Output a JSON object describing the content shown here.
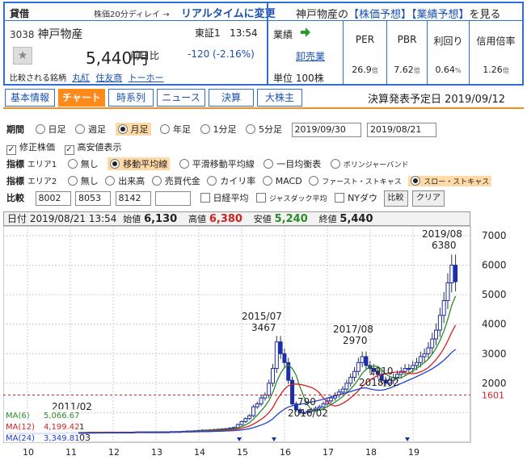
{
  "header": {
    "loan_label": "貸借",
    "delay_note": "株価20分ディレイ →",
    "realtime_link": "リアルタイムに変更",
    "see_prefix": "神戸物産の",
    "stock_forecast_link": "【株価予想】",
    "earnings_forecast_link": "【業績予想】",
    "see_suffix": "を見る"
  },
  "stock": {
    "code": "3038",
    "name": "神戸物産",
    "market": "東証1",
    "time": "13:54",
    "price": "5,440円",
    "diff_label": "前日比",
    "diff_value": "-120 (-2.16%)",
    "compare_label": "比較される銘柄",
    "compare_links": [
      "丸紅",
      "住友商",
      "トーホー"
    ]
  },
  "performance": {
    "label": "業績",
    "link": "卸売業",
    "unit": "単位 100株"
  },
  "stats": [
    {
      "header": "PER",
      "value": "26.9",
      "unit": "倍"
    },
    {
      "header": "PBR",
      "value": "7.62",
      "unit": "倍"
    },
    {
      "header": "利回り",
      "value": "0.64",
      "unit": "%"
    },
    {
      "header": "信用倍率",
      "value": "1.26",
      "unit": "倍"
    }
  ],
  "tabs": [
    "基本情報",
    "チャート",
    "時系列",
    "ニュース",
    "決算",
    "大株主"
  ],
  "earnings_date": "決算発表予定日 2019/09/12",
  "period": {
    "label": "期間",
    "options": [
      "日足",
      "週足",
      "月足",
      "年足",
      "1分足",
      "5分足"
    ],
    "selected": "月足",
    "date_from": "2019/09/30",
    "date_to": "2019/08/21"
  },
  "checks": {
    "adjusted": "修正株価",
    "high_low": "高安値表示"
  },
  "indicator1": {
    "label": "指標",
    "area": "エリア1",
    "options": [
      "無し",
      "移動平均線",
      "平滑移動平均線",
      "一目均衡表",
      "ボリンジャーバンド"
    ],
    "selected": "移動平均線"
  },
  "indicator2": {
    "label": "指標",
    "area": "エリア2",
    "options": [
      "無し",
      "出来高",
      "売買代金",
      "カイリ率",
      "MACD",
      "ファースト・ストキャス",
      "スロー・ストキャス"
    ],
    "selected": "スロー・ストキャス"
  },
  "compare": {
    "label": "比較",
    "codes": [
      "8002",
      "8053",
      "8142",
      ""
    ],
    "checks": [
      "日経平均",
      "ジャスダック平均",
      "NYダウ"
    ],
    "compare_button": "比較",
    "clear_button": "クリア"
  },
  "chart_head": {
    "date_label": "日付",
    "date": "2019/08/21 13:54",
    "open_label": "始値",
    "open": "6,130",
    "high_label": "高値",
    "high": "6,380",
    "low_label": "安値",
    "low": "5,240",
    "close_label": "終値",
    "close": "5,440"
  },
  "chart_data": {
    "type": "candlestick",
    "ylim": [
      0,
      7000
    ],
    "yticks": [
      1000,
      2000,
      3000,
      4000,
      5000,
      6000,
      7000
    ],
    "ytick_labels": [
      "",
      "2000",
      "3000",
      "4000",
      "5000",
      "6000",
      "7000"
    ],
    "current_price_marker": "1601",
    "xticks": [
      "10",
      "11",
      "12",
      "13",
      "14",
      "15",
      "16",
      "17",
      "18",
      "19"
    ],
    "annotations": [
      {
        "label": "2019/08",
        "value": "6380"
      },
      {
        "label": "2015/07",
        "value": "3467"
      },
      {
        "label": "2017/08",
        "value": "2970"
      },
      {
        "label": "2018/02",
        "value": "1910"
      },
      {
        "label": "2016/02",
        "value": "790"
      },
      {
        "label": "2011/02",
        "value": ""
      }
    ],
    "ma": [
      {
        "name": "MA(6)",
        "value": "5,066.67",
        "color": "#2a8a2a"
      },
      {
        "name": "MA(12)",
        "value": "4,199.42",
        "color": "#d42020"
      },
      {
        "name": "MA(24)",
        "value": "3,349.81",
        "color": "#2040d0"
      }
    ],
    "bottom_note": "03",
    "bottom_left_value": "1",
    "close": [
      300,
      300,
      300,
      300,
      300,
      300,
      300,
      300,
      300,
      300,
      300,
      300,
      300,
      310,
      320,
      330,
      330,
      330,
      330,
      330,
      330,
      340,
      340,
      340,
      340,
      340,
      340,
      340,
      340,
      340,
      340,
      340,
      340,
      350,
      350,
      350,
      350,
      350,
      350,
      350,
      350,
      350,
      360,
      360,
      360,
      370,
      380,
      380,
      390,
      400,
      410,
      410,
      420,
      430,
      440,
      450,
      460,
      480,
      500,
      600,
      700,
      800,
      900,
      1200,
      1300,
      1500,
      1600,
      2000,
      2500,
      3400,
      3000,
      2700,
      2100,
      1300,
      1100,
      1000,
      1000,
      1050,
      1100,
      1150,
      1200,
      1300,
      1400,
      1500,
      1600,
      1700,
      1800,
      2000,
      2200,
      2400,
      2700,
      2900,
      2600,
      2500,
      2400,
      2300,
      2100,
      2000,
      2100,
      2200,
      2300,
      2400,
      2500,
      2500,
      2600,
      2700,
      2900,
      3000,
      3200,
      3500,
      3800,
      4300,
      4800,
      5400,
      6000,
      5440
    ]
  }
}
